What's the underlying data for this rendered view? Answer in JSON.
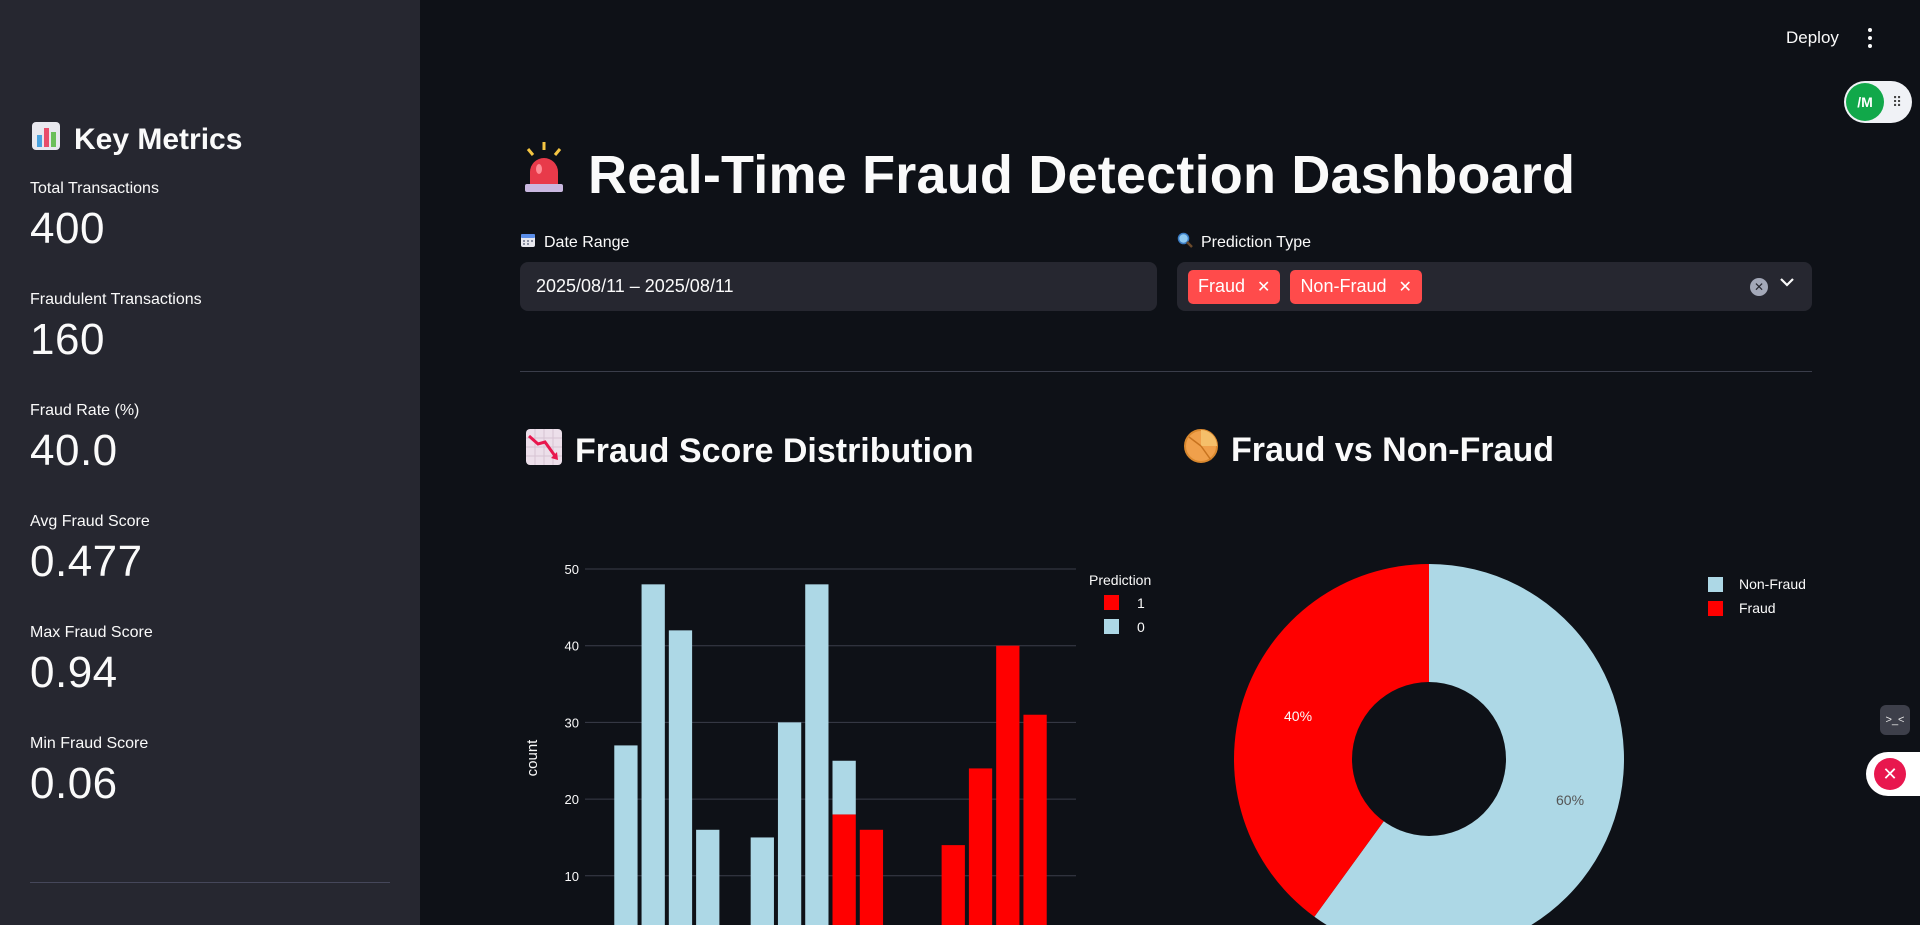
{
  "header": {
    "deploy_label": "Deploy",
    "toggle_logo": "/M"
  },
  "sidebar": {
    "title": "Key Metrics",
    "metrics": [
      {
        "label": "Total Transactions",
        "value": "400"
      },
      {
        "label": "Fraudulent Transactions",
        "value": "160"
      },
      {
        "label": "Fraud Rate (%)",
        "value": "40.0"
      },
      {
        "label": "Avg Fraud Score",
        "value": "0.477"
      },
      {
        "label": "Max Fraud Score",
        "value": "0.94"
      },
      {
        "label": "Min Fraud Score",
        "value": "0.06"
      }
    ]
  },
  "main": {
    "title": "Real-Time Fraud Detection Dashboard",
    "date_range": {
      "label": "Date Range",
      "value": "2025/08/11 – 2025/08/11"
    },
    "prediction_type": {
      "label": "Prediction Type",
      "tags": [
        "Fraud",
        "Non-Fraud"
      ]
    },
    "histogram_title": "Fraud Score Distribution",
    "pie_title": "Fraud vs Non-Fraud"
  },
  "colors": {
    "fraud": "#ff0000",
    "non_fraud": "#add8e6",
    "accent": "#ff4b4b",
    "background": "#0e1117",
    "sidebar": "#262730"
  },
  "chart_data": [
    {
      "type": "bar",
      "title": "",
      "xlabel": "",
      "ylabel": "count",
      "ylim": [
        0,
        50
      ],
      "yticks": [
        10,
        20,
        30,
        40,
        50
      ],
      "grid": true,
      "barmode": "stack",
      "legend": {
        "title": "Prediction",
        "placement": "top-right",
        "entries": [
          "1",
          "0"
        ]
      },
      "series": [
        {
          "name": "0",
          "color": "#add8e6",
          "values": [
            0.3,
            27,
            48,
            42,
            16,
            0,
            15,
            30,
            48,
            7,
            0,
            0,
            0,
            0,
            0,
            0,
            0,
            0
          ]
        },
        {
          "name": "1",
          "color": "#ff0000",
          "values": [
            0,
            0,
            0,
            0,
            0,
            0,
            0,
            0,
            0,
            18,
            16,
            1,
            1,
            14,
            24,
            40,
            31,
            3
          ]
        }
      ]
    },
    {
      "type": "pie",
      "title": "",
      "hole": 0.4,
      "labels": [
        "Non-Fraud",
        "Fraud"
      ],
      "values": [
        60,
        40
      ],
      "text_labels": [
        "60%",
        "40%"
      ],
      "colors": [
        "#add8e6",
        "#ff0000"
      ],
      "legend": {
        "placement": "top-right",
        "entries": [
          "Non-Fraud",
          "Fraud"
        ]
      }
    }
  ]
}
